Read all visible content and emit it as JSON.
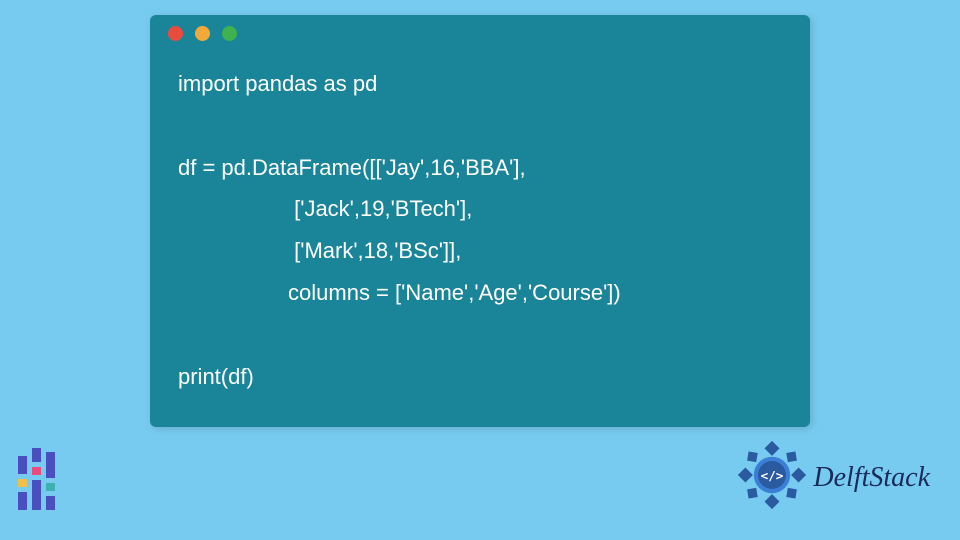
{
  "code": {
    "lines": [
      "import pandas as pd",
      "",
      "df = pd.DataFrame([['Jay',16,'BBA'],",
      "                   ['Jack',19,'BTech'],",
      "                   ['Mark',18,'BSc']],",
      "                  columns = ['Name','Age','Course'])",
      "",
      "print(df)"
    ]
  },
  "brand": {
    "name": "DelftStack"
  },
  "colors": {
    "bg": "#78cbf0",
    "window": "#1a8599",
    "brand_text": "#1a2a5a"
  }
}
